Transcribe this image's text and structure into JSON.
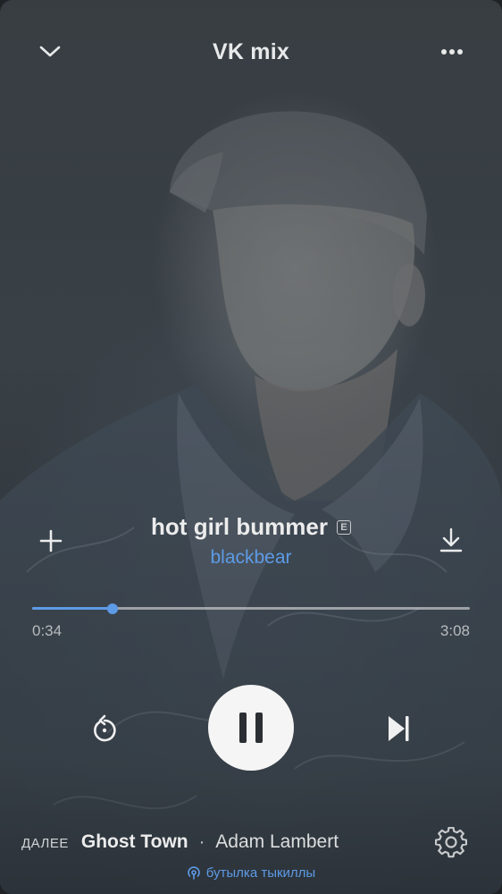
{
  "header": {
    "title": "VK mix",
    "collapse_icon": "chevron-down-icon",
    "more_icon": "more-horizontal-icon"
  },
  "track": {
    "title": "hot girl bummer",
    "explicit_badge": "E",
    "artist": "blackbear",
    "add_icon": "plus-icon",
    "download_icon": "download-icon"
  },
  "progress": {
    "elapsed": "0:34",
    "duration": "3:08",
    "fraction": 0.184
  },
  "controls": {
    "repeat_icon": "repeat-one-icon",
    "play_state_icon": "pause-icon",
    "next_icon": "skip-next-icon"
  },
  "up_next": {
    "label": "ДАЛЕЕ",
    "title": "Ghost Town",
    "separator": "·",
    "artist": "Adam Lambert",
    "settings_icon": "gear-icon"
  },
  "broadcast": {
    "icon": "broadcast-icon",
    "text": "бутылка тыкиллы"
  },
  "colors": {
    "accent": "#5d9be6",
    "background": "#394046"
  }
}
